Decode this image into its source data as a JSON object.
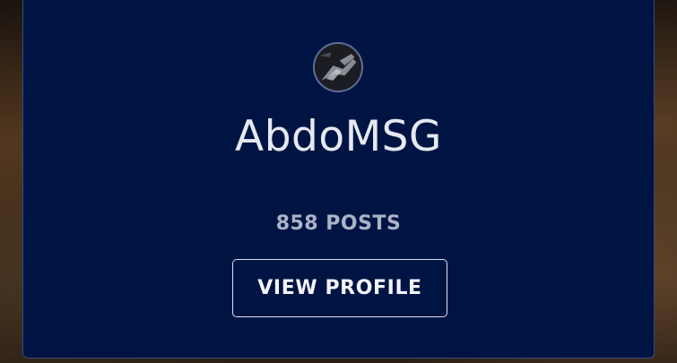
{
  "profile": {
    "username": "AbdoMSG",
    "posts_label": "858 POSTS",
    "view_profile_label": "VIEW PROFILE"
  },
  "colors": {
    "card_background": "#001443",
    "text_primary": "#e6e9f2",
    "text_secondary": "#aab3c7",
    "button_border": "#d9def0"
  },
  "icons": {
    "avatar": "profile-avatar-image"
  }
}
